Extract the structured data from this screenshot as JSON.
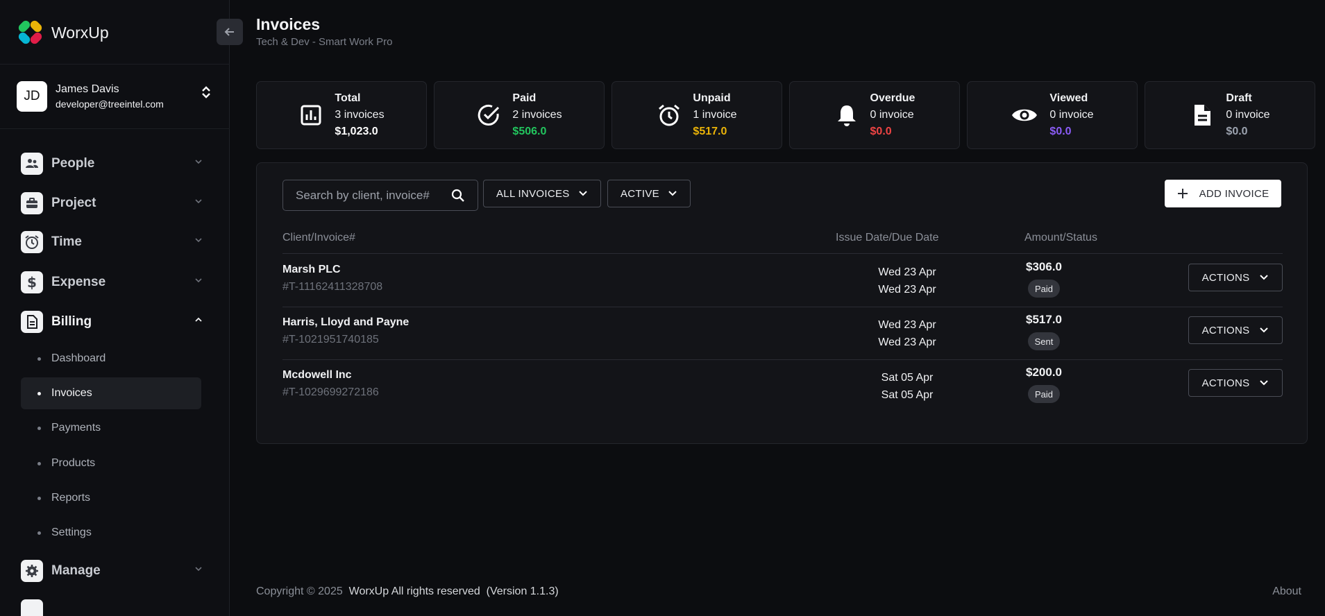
{
  "brand": {
    "name": "WorxUp"
  },
  "user": {
    "initials": "JD",
    "name": "James Davis",
    "email": "developer@treeintel.com"
  },
  "nav": [
    {
      "label": "People",
      "icon": "users-icon"
    },
    {
      "label": "Project",
      "icon": "briefcase-icon"
    },
    {
      "label": "Time",
      "icon": "clock-icon"
    },
    {
      "label": "Expense",
      "icon": "dollar-icon"
    },
    {
      "label": "Billing",
      "icon": "document-icon"
    },
    {
      "label": "Manage",
      "icon": "gear-icon"
    }
  ],
  "billing_sub": [
    "Dashboard",
    "Invoices",
    "Payments",
    "Products",
    "Reports",
    "Settings"
  ],
  "header": {
    "title": "Invoices",
    "subtitle": "Tech & Dev - Smart Work Pro"
  },
  "stats": [
    {
      "title": "Total",
      "count": "3 invoices",
      "amount": "$1,023.0",
      "color": "#ffffff",
      "icon": "bar-chart-icon"
    },
    {
      "title": "Paid",
      "count": "2 invoices",
      "amount": "$506.0",
      "color": "#22c55e",
      "icon": "check-circle-icon"
    },
    {
      "title": "Unpaid",
      "count": "1 invoice",
      "amount": "$517.0",
      "color": "#eab308",
      "icon": "alarm-icon"
    },
    {
      "title": "Overdue",
      "count": "0 invoice",
      "amount": "$0.0",
      "color": "#ef4444",
      "icon": "bell-icon"
    },
    {
      "title": "Viewed",
      "count": "0 invoice",
      "amount": "$0.0",
      "color": "#8b5cf6",
      "icon": "eye-icon"
    },
    {
      "title": "Draft",
      "count": "0 invoice",
      "amount": "$0.0",
      "color": "#9ca3af",
      "icon": "file-icon"
    }
  ],
  "filters": {
    "search_placeholder": "Search by client, invoice#",
    "type": "ALL INVOICES",
    "state": "ACTIVE",
    "add_label": "ADD INVOICE"
  },
  "table": {
    "headers": [
      "Client/Invoice#",
      "Issue Date/Due Date",
      "Amount/Status"
    ],
    "actions_label": "ACTIONS",
    "rows": [
      {
        "client": "Marsh PLC",
        "invoice": "#T-11162411328708",
        "issue": "Wed 23 Apr",
        "due": "Wed 23 Apr",
        "amount": "$306.0",
        "status": "Paid"
      },
      {
        "client": "Harris, Lloyd and Payne",
        "invoice": "#T-1021951740185",
        "issue": "Wed 23 Apr",
        "due": "Wed 23 Apr",
        "amount": "$517.0",
        "status": "Sent"
      },
      {
        "client": "Mcdowell Inc",
        "invoice": "#T-1029699272186",
        "issue": "Sat 05 Apr",
        "due": "Sat 05 Apr",
        "amount": "$200.0",
        "status": "Paid"
      }
    ]
  },
  "footer": {
    "copyright": "Copyright © 2025",
    "brand": "WorxUp All rights reserved",
    "version": "(Version 1.1.3)",
    "about": "About"
  }
}
